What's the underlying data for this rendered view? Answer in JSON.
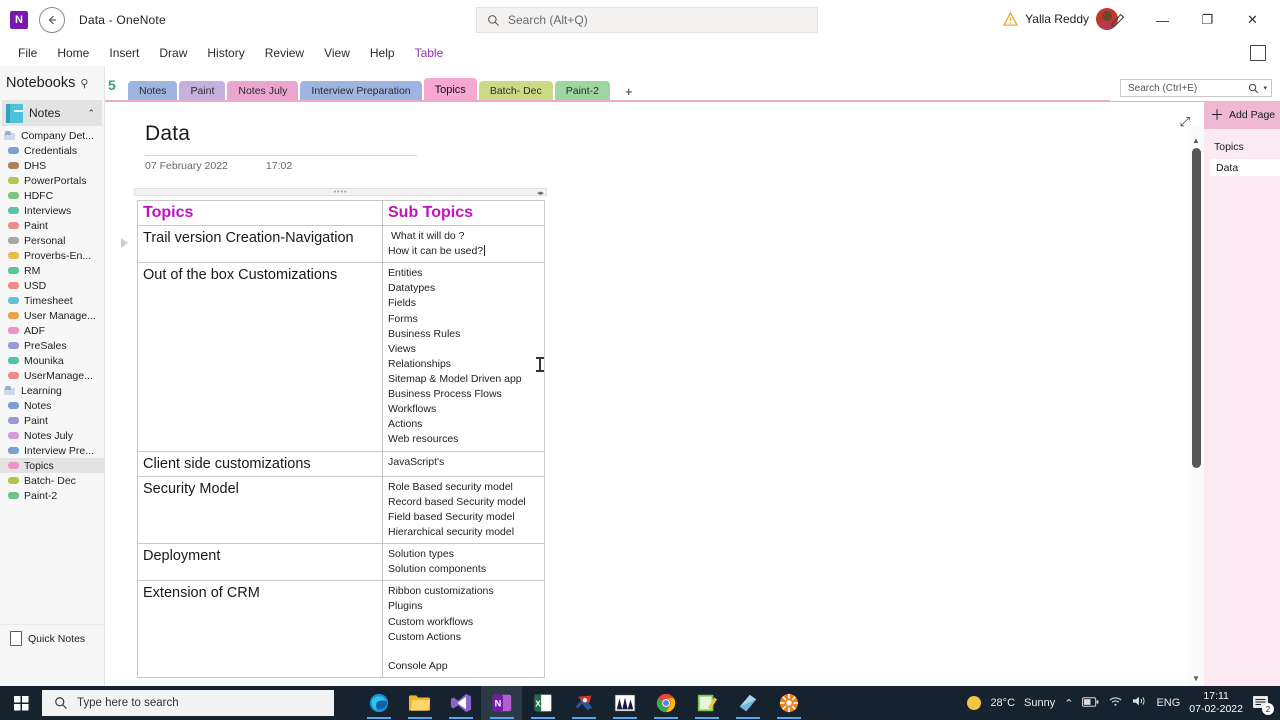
{
  "window": {
    "app_logo": "N",
    "title": "Data - OneNote",
    "back_icon": "back-arrow",
    "top_search_placeholder": "Search (Alt+Q)",
    "account_name": "Yalla Reddy",
    "warning_icon": "warning-triangle",
    "buttons": {
      "ink": "✎",
      "minimize": "—",
      "maximize": "❐",
      "close": "✕"
    }
  },
  "ribbon": {
    "items": [
      "File",
      "Home",
      "Insert",
      "Draw",
      "History",
      "Review",
      "View",
      "Help",
      "Table"
    ],
    "accent_item": "Table",
    "accent_color": "#9233b3"
  },
  "right_search": {
    "placeholder": "Search (Ctrl+E)"
  },
  "notebooks": {
    "header": "Notebooks",
    "pin_icon": "pin-icon",
    "selected_notebook": "Notes",
    "collapse_icon": "chevron-up-icon",
    "items": [
      {
        "label": "Company Det...",
        "color": "#8fb3d6",
        "type": "group"
      },
      {
        "label": "Credentials",
        "color": "#7e9fd4",
        "type": "section"
      },
      {
        "label": "DHS",
        "color": "#b08058",
        "type": "section"
      },
      {
        "label": "PowerPortals",
        "color": "#b4c44e",
        "type": "section"
      },
      {
        "label": "HDFC",
        "color": "#7fc47f",
        "type": "section"
      },
      {
        "label": "Interviews",
        "color": "#5bc4a0",
        "type": "section"
      },
      {
        "label": "Paint",
        "color": "#ec8e8e",
        "type": "section"
      },
      {
        "label": "Personal",
        "color": "#a8a8a8",
        "type": "section"
      },
      {
        "label": "Proverbs-En...",
        "color": "#e8bc47",
        "type": "section"
      },
      {
        "label": "RM",
        "color": "#5bc49a",
        "type": "section"
      },
      {
        "label": "USD",
        "color": "#ef8a8a",
        "type": "section"
      },
      {
        "label": "Timesheet",
        "color": "#5fc0da",
        "type": "section"
      },
      {
        "label": "User Manage...",
        "color": "#e8a54e",
        "type": "section"
      },
      {
        "label": "ADF",
        "color": "#ef93c4",
        "type": "section"
      },
      {
        "label": "PreSales",
        "color": "#9a9ad8",
        "type": "section"
      },
      {
        "label": "Mounika",
        "color": "#4dc4a8",
        "type": "section"
      },
      {
        "label": "UserManage...",
        "color": "#ef8a8a",
        "type": "section"
      },
      {
        "label": "Learning",
        "color": "#8fb3d6",
        "type": "group"
      },
      {
        "label": "Notes",
        "color": "#7e9fd4",
        "type": "section"
      },
      {
        "label": "Paint",
        "color": "#9a9ad8",
        "type": "section"
      },
      {
        "label": "Notes July",
        "color": "#d89ad8",
        "type": "section"
      },
      {
        "label": "Interview Pre...",
        "color": "#7e9fd4",
        "type": "section"
      },
      {
        "label": "Topics",
        "color": "#ef93c4",
        "type": "section",
        "selected": true
      },
      {
        "label": "Batch- Dec",
        "color": "#b4c44e",
        "type": "section"
      },
      {
        "label": "Paint-2",
        "color": "#6cc48a",
        "type": "section"
      }
    ],
    "quick_notes": "Quick Notes",
    "quick_notes_icon": "page-icon"
  },
  "section_tabs": {
    "count_badge": "5",
    "add_label": "+",
    "items": [
      {
        "label": "Notes",
        "color": "#9fb4e0",
        "active": false
      },
      {
        "label": "Paint",
        "color": "#c6b0e0",
        "active": false
      },
      {
        "label": "Notes July",
        "color": "#eba6cf",
        "active": false
      },
      {
        "label": "Interview Preparation",
        "color": "#9fb4e0",
        "active": false
      },
      {
        "label": "Topics",
        "color": "#f6a8d0",
        "active": true
      },
      {
        "label": "Batch- Dec",
        "color": "#cada86",
        "active": false
      },
      {
        "label": "Paint-2",
        "color": "#9dd6a0",
        "active": false
      }
    ]
  },
  "page": {
    "title": "Data",
    "date": "07 February 2022",
    "time": "17:02",
    "expand_icon": "expand-diagonal-icon",
    "block_handle_icon": "drag-dots",
    "paragraph_handle_icon": "collapse-triangle-icon"
  },
  "table": {
    "headers": [
      "Topics",
      "Sub Topics"
    ],
    "header_color": "#c012c0",
    "rows": [
      {
        "topic": "Trail version Creation-Navigation",
        "subs": [
          " What it will do ?",
          "How it can be used?"
        ],
        "caret_on_last": true
      },
      {
        "topic": "Out of the box Customizations",
        "subs": [
          "Entities",
          "Datatypes",
          "Fields",
          "Forms",
          "Business Rules",
          "Views",
          "Relationships",
          "Sitemap & Model Driven app",
          "Business Process Flows",
          "Workflows",
          "Actions",
          "Web resources"
        ]
      },
      {
        "topic": "Client side customizations",
        "subs": [
          "JavaScript's"
        ]
      },
      {
        "topic": "Security Model",
        "subs": [
          "Role Based security model",
          "Record based Security model",
          "Field based Security model",
          "Hierarchical security model"
        ]
      },
      {
        "topic": "Deployment",
        "subs": [
          "Solution types",
          "Solution components"
        ]
      },
      {
        "topic": "Extension of CRM",
        "subs": [
          "Ribbon customizations",
          "Plugins",
          "Custom workflows",
          "Custom Actions",
          "",
          "Console App"
        ]
      }
    ]
  },
  "page_pane": {
    "add_page": "Add Page",
    "add_page_icon": "plus-icon",
    "section_name": "Topics",
    "pages": [
      "Data"
    ],
    "selected_page": "Data"
  },
  "taskbar": {
    "start_icon": "windows-logo",
    "search_placeholder": "Type here to search",
    "search_icon": "search-icon",
    "apps": [
      {
        "name": "edge",
        "active": false
      },
      {
        "name": "file-explorer",
        "active": false
      },
      {
        "name": "vs-code",
        "active": false
      },
      {
        "name": "onenote",
        "active": true
      },
      {
        "name": "excel",
        "active": false
      },
      {
        "name": "visual-studio",
        "active": false
      },
      {
        "name": "chart-app",
        "active": false
      },
      {
        "name": "chrome",
        "active": false
      },
      {
        "name": "notepad-plus",
        "active": false
      },
      {
        "name": "blue-app",
        "active": false
      },
      {
        "name": "orange-app",
        "active": false
      }
    ],
    "weather_temp": "28°C",
    "weather_desc": "Sunny",
    "weather_icon": "sun-icon",
    "chevron_icon": "chevron-up-icon",
    "battery_icon": "battery-icon",
    "wifi_icon": "wifi-icon",
    "volume_icon": "speaker-icon",
    "language": "ENG",
    "clock_time": "17:11",
    "clock_date": "07-02-2022",
    "notification_count": "2",
    "notification_icon": "notification-icon"
  }
}
